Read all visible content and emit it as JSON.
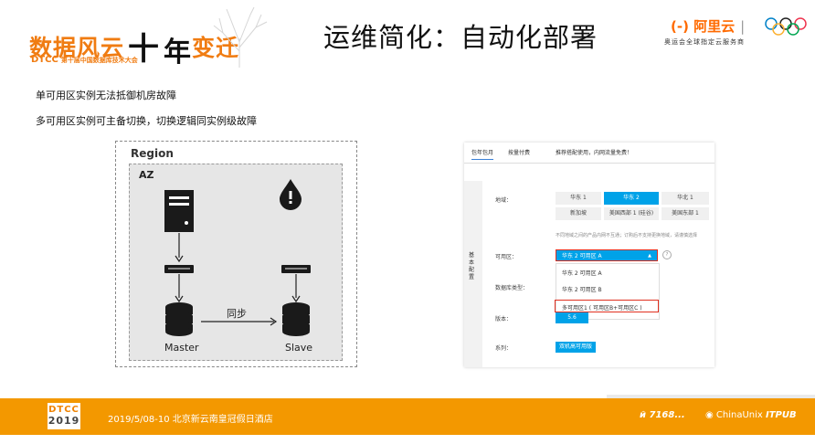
{
  "header": {
    "event_logo_main": "数据风云",
    "event_logo_chars": [
      "十",
      "年",
      "变迁"
    ],
    "event_logo_sub_brand": "DTCC",
    "event_logo_sub_text": "第十届中国数据库技术大会",
    "title": "运维简化：自动化部署",
    "sponsor_logo": "(-) 阿里云",
    "sponsor_sub": "奥运会全球指定云服务商"
  },
  "bullets": [
    "单可用区实例无法抵御机房故障",
    "多可用区实例可主备切换，切换逻辑同实例级故障"
  ],
  "diagram": {
    "region_label": "Region",
    "az_label": "AZ",
    "sync_label": "同步",
    "master_label": "Master",
    "slave_label": "Slave"
  },
  "console": {
    "tabs": [
      "包年包月",
      "按量付费"
    ],
    "tab_note": "推荐搭配使用，内网流量免费！",
    "side_label": "基本配置",
    "region_label": "地域：",
    "regions": [
      "华东 1",
      "华东 2",
      "华北 1",
      "新加坡",
      "美国西部 1 (硅谷)",
      "美国东部 1"
    ],
    "selected_region": "华东 2",
    "region_note": "不同地域之间的产品内网不互通；订购后不支持更换地域，请谨慎选择",
    "zone_label": "可用区：",
    "zone_value": "华东 2 可用区 A",
    "zone_options": [
      "华东 2 可用区 A",
      "华东 2 可用区 B",
      "多可用区1 ( 可用区B+可用区C )"
    ],
    "db_type_label": "数据库类型：",
    "version_label": "版本：",
    "version_value": "5.6",
    "series_label": "系列：",
    "series_value": "双机高可用版"
  },
  "footer": {
    "brand_top": "DTCC",
    "brand_bottom": "2019",
    "date_venue": "2019/5/08-10  北京新云南皇冠假日酒店",
    "sponsors": [
      "й 7168...",
      "ChinaUnix",
      "ITPUB"
    ]
  },
  "colors": {
    "orange": "#f39800",
    "blue": "#00a2e8",
    "highlight_red": "#e03020"
  }
}
